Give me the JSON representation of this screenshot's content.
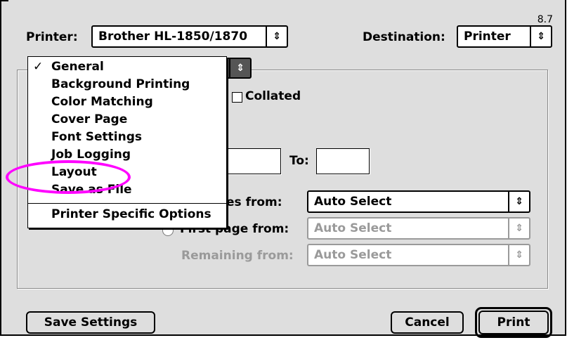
{
  "dialog": {
    "version": "8.7",
    "printer_label": "Printer:",
    "printer_value": "Brother HL-1850/1870",
    "destination_label": "Destination:",
    "destination_value": "Printer"
  },
  "menu": {
    "items": [
      {
        "label": "General",
        "checked": true
      },
      {
        "label": "Background Printing"
      },
      {
        "label": "Color Matching"
      },
      {
        "label": "Cover Page"
      },
      {
        "label": "Font Settings"
      },
      {
        "label": "Job Logging"
      },
      {
        "label": "Layout",
        "highlighted": true
      },
      {
        "label": "Save as File"
      },
      {
        "label": "Printer Specific Options"
      }
    ],
    "check_mark": "✓",
    "highlight_color": "#ff00ff"
  },
  "general": {
    "collated_label": "Collated",
    "to_label": "To:",
    "paper_source_label_partial": "es from:",
    "paper_source_value": "Auto Select",
    "first_page_label": "First page from:",
    "first_page_value": "Auto Select",
    "remaining_label": "Remaining from:",
    "remaining_value": "Auto Select"
  },
  "buttons": {
    "save_settings": "Save Settings",
    "cancel": "Cancel",
    "print": "Print"
  },
  "icons": {
    "popup_arrow": "updown-arrows-icon"
  }
}
